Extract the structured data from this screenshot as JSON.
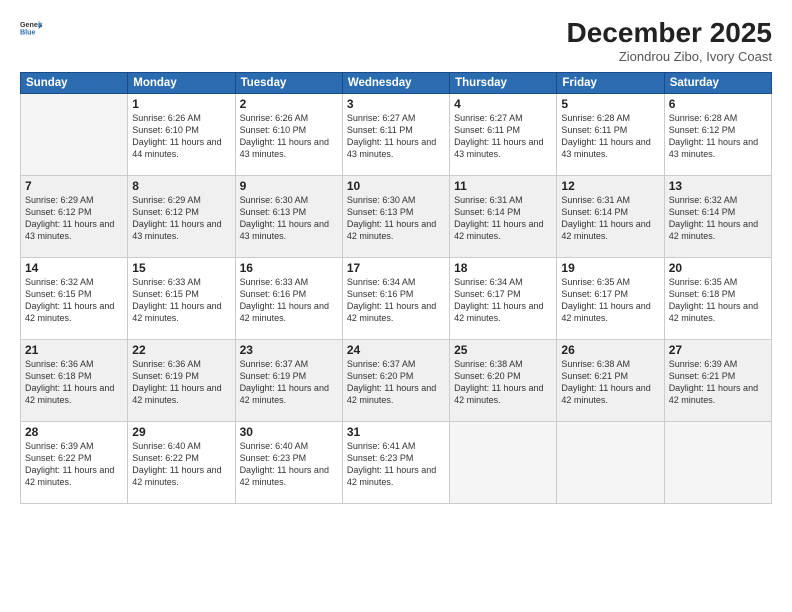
{
  "header": {
    "logo_general": "General",
    "logo_blue": "Blue",
    "month": "December 2025",
    "location": "Ziondrou Zibo, Ivory Coast"
  },
  "weekdays": [
    "Sunday",
    "Monday",
    "Tuesday",
    "Wednesday",
    "Thursday",
    "Friday",
    "Saturday"
  ],
  "weeks": [
    [
      {
        "day": "",
        "empty": true
      },
      {
        "day": "1",
        "sunrise": "6:26 AM",
        "sunset": "6:10 PM",
        "daylight": "11 hours and 44 minutes."
      },
      {
        "day": "2",
        "sunrise": "6:26 AM",
        "sunset": "6:10 PM",
        "daylight": "11 hours and 43 minutes."
      },
      {
        "day": "3",
        "sunrise": "6:27 AM",
        "sunset": "6:11 PM",
        "daylight": "11 hours and 43 minutes."
      },
      {
        "day": "4",
        "sunrise": "6:27 AM",
        "sunset": "6:11 PM",
        "daylight": "11 hours and 43 minutes."
      },
      {
        "day": "5",
        "sunrise": "6:28 AM",
        "sunset": "6:11 PM",
        "daylight": "11 hours and 43 minutes."
      },
      {
        "day": "6",
        "sunrise": "6:28 AM",
        "sunset": "6:12 PM",
        "daylight": "11 hours and 43 minutes."
      }
    ],
    [
      {
        "day": "7",
        "sunrise": "6:29 AM",
        "sunset": "6:12 PM",
        "daylight": "11 hours and 43 minutes."
      },
      {
        "day": "8",
        "sunrise": "6:29 AM",
        "sunset": "6:12 PM",
        "daylight": "11 hours and 43 minutes."
      },
      {
        "day": "9",
        "sunrise": "6:30 AM",
        "sunset": "6:13 PM",
        "daylight": "11 hours and 43 minutes."
      },
      {
        "day": "10",
        "sunrise": "6:30 AM",
        "sunset": "6:13 PM",
        "daylight": "11 hours and 42 minutes."
      },
      {
        "day": "11",
        "sunrise": "6:31 AM",
        "sunset": "6:14 PM",
        "daylight": "11 hours and 42 minutes."
      },
      {
        "day": "12",
        "sunrise": "6:31 AM",
        "sunset": "6:14 PM",
        "daylight": "11 hours and 42 minutes."
      },
      {
        "day": "13",
        "sunrise": "6:32 AM",
        "sunset": "6:14 PM",
        "daylight": "11 hours and 42 minutes."
      }
    ],
    [
      {
        "day": "14",
        "sunrise": "6:32 AM",
        "sunset": "6:15 PM",
        "daylight": "11 hours and 42 minutes."
      },
      {
        "day": "15",
        "sunrise": "6:33 AM",
        "sunset": "6:15 PM",
        "daylight": "11 hours and 42 minutes."
      },
      {
        "day": "16",
        "sunrise": "6:33 AM",
        "sunset": "6:16 PM",
        "daylight": "11 hours and 42 minutes."
      },
      {
        "day": "17",
        "sunrise": "6:34 AM",
        "sunset": "6:16 PM",
        "daylight": "11 hours and 42 minutes."
      },
      {
        "day": "18",
        "sunrise": "6:34 AM",
        "sunset": "6:17 PM",
        "daylight": "11 hours and 42 minutes."
      },
      {
        "day": "19",
        "sunrise": "6:35 AM",
        "sunset": "6:17 PM",
        "daylight": "11 hours and 42 minutes."
      },
      {
        "day": "20",
        "sunrise": "6:35 AM",
        "sunset": "6:18 PM",
        "daylight": "11 hours and 42 minutes."
      }
    ],
    [
      {
        "day": "21",
        "sunrise": "6:36 AM",
        "sunset": "6:18 PM",
        "daylight": "11 hours and 42 minutes."
      },
      {
        "day": "22",
        "sunrise": "6:36 AM",
        "sunset": "6:19 PM",
        "daylight": "11 hours and 42 minutes."
      },
      {
        "day": "23",
        "sunrise": "6:37 AM",
        "sunset": "6:19 PM",
        "daylight": "11 hours and 42 minutes."
      },
      {
        "day": "24",
        "sunrise": "6:37 AM",
        "sunset": "6:20 PM",
        "daylight": "11 hours and 42 minutes."
      },
      {
        "day": "25",
        "sunrise": "6:38 AM",
        "sunset": "6:20 PM",
        "daylight": "11 hours and 42 minutes."
      },
      {
        "day": "26",
        "sunrise": "6:38 AM",
        "sunset": "6:21 PM",
        "daylight": "11 hours and 42 minutes."
      },
      {
        "day": "27",
        "sunrise": "6:39 AM",
        "sunset": "6:21 PM",
        "daylight": "11 hours and 42 minutes."
      }
    ],
    [
      {
        "day": "28",
        "sunrise": "6:39 AM",
        "sunset": "6:22 PM",
        "daylight": "11 hours and 42 minutes."
      },
      {
        "day": "29",
        "sunrise": "6:40 AM",
        "sunset": "6:22 PM",
        "daylight": "11 hours and 42 minutes."
      },
      {
        "day": "30",
        "sunrise": "6:40 AM",
        "sunset": "6:23 PM",
        "daylight": "11 hours and 42 minutes."
      },
      {
        "day": "31",
        "sunrise": "6:41 AM",
        "sunset": "6:23 PM",
        "daylight": "11 hours and 42 minutes."
      },
      {
        "day": "",
        "empty": true
      },
      {
        "day": "",
        "empty": true
      },
      {
        "day": "",
        "empty": true
      }
    ]
  ]
}
